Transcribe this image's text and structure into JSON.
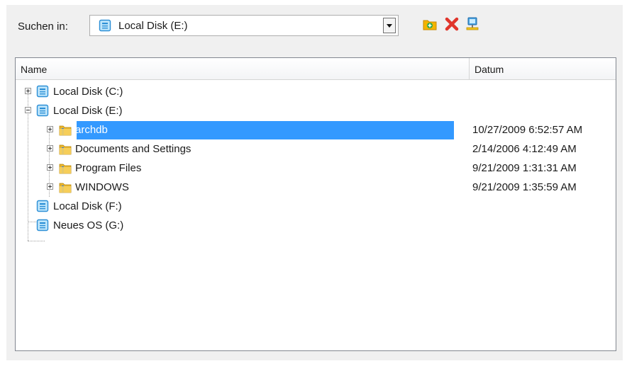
{
  "toolbar": {
    "look_in_label": "Suchen in:",
    "location_value": "Local Disk (E:)",
    "location_icon": "disk-icon",
    "buttons": [
      {
        "name": "new-folder-button",
        "icon": "new-folder-icon"
      },
      {
        "name": "delete-button",
        "icon": "delete-icon"
      },
      {
        "name": "network-button",
        "icon": "network-icon"
      }
    ]
  },
  "list": {
    "columns": [
      "Name",
      "Datum"
    ],
    "rows": [
      {
        "label": "Local Disk (C:)",
        "icon": "disk-icon",
        "date": "",
        "expander": "plus"
      },
      {
        "label": "Local Disk (E:)",
        "icon": "disk-icon",
        "date": "",
        "expander": "minus"
      },
      {
        "label": "archdb",
        "icon": "folder-icon",
        "date": "10/27/2009 6:52:57 AM",
        "expander": "plus",
        "selected": true
      },
      {
        "label": "Documents and Settings",
        "icon": "folder-icon",
        "date": "2/14/2006 4:12:49 AM",
        "expander": "plus"
      },
      {
        "label": "Program Files",
        "icon": "folder-icon",
        "date": "9/21/2009 1:31:31 AM",
        "expander": "plus"
      },
      {
        "label": "WINDOWS",
        "icon": "folder-icon",
        "date": "9/21/2009 1:35:59 AM",
        "expander": "plus"
      },
      {
        "label": "Local Disk (F:)",
        "icon": "disk-icon",
        "date": "",
        "expander": "none"
      },
      {
        "label": "Neues OS (G:)",
        "icon": "disk-icon",
        "date": "",
        "expander": "none"
      }
    ]
  },
  "colors": {
    "selection": "#3399ff",
    "dialog_bg": "#f0f0f0"
  }
}
